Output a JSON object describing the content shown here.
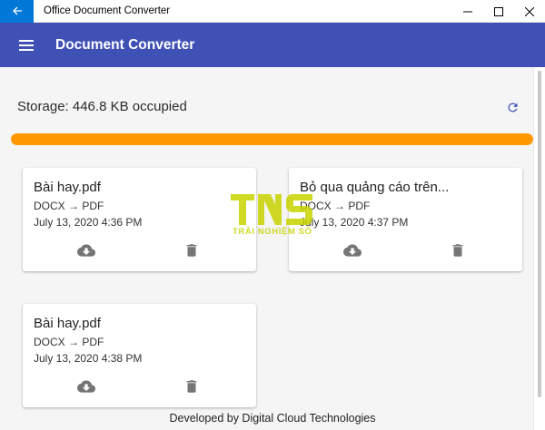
{
  "window": {
    "title": "Office Document Converter"
  },
  "appbar": {
    "title": "Document Converter"
  },
  "storage": {
    "label": "Storage: 446.8 KB occupied",
    "fill_fraction": 1.0
  },
  "files": [
    {
      "name": "Bài hay.pdf",
      "conversion": "DOCX → PDF",
      "date": "July 13, 2020 4:36 PM"
    },
    {
      "name": "Bỏ qua quảng cáo trên...",
      "conversion": "DOCX → PDF",
      "date": "July 13, 2020 4:37 PM"
    },
    {
      "name": "Bài hay.pdf",
      "conversion": "DOCX → PDF",
      "date": "July 13, 2020 4:38 PM"
    }
  ],
  "footer": {
    "text": "Developed by Digital Cloud Technologies"
  },
  "watermark": {
    "logo": "TNS",
    "subtitle": "TRẢI NGHIỆM SỐ"
  },
  "colors": {
    "appbar": "#3f51b5",
    "accent": "#ff9800",
    "titlebar_back": "#0078d7",
    "icon": "#757575"
  },
  "icons": {
    "back": "arrow-left-icon",
    "menu": "hamburger-icon",
    "refresh": "refresh-icon",
    "download": "cloud-download-icon",
    "delete": "trash-icon"
  }
}
